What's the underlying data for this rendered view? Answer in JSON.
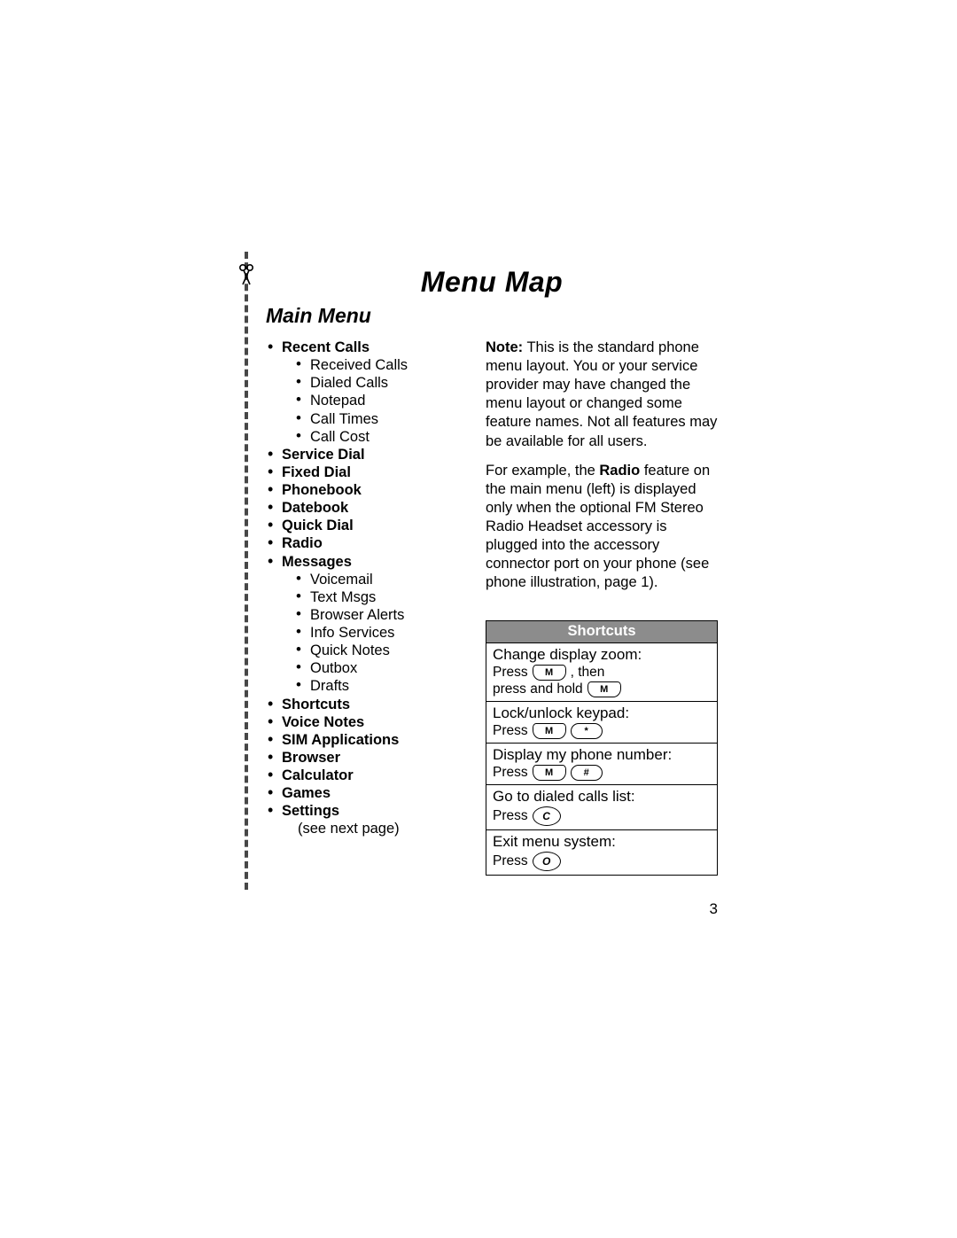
{
  "page_number": "3",
  "title": "Menu Map",
  "subtitle": "Main Menu",
  "menu": [
    {
      "label": "Recent Calls",
      "children": [
        {
          "label": "Received Calls"
        },
        {
          "label": "Dialed Calls"
        },
        {
          "label": "Notepad"
        },
        {
          "label": "Call Times"
        },
        {
          "label": "Call Cost"
        }
      ]
    },
    {
      "label": "Service Dial"
    },
    {
      "label": "Fixed Dial"
    },
    {
      "label": "Phonebook"
    },
    {
      "label": "Datebook"
    },
    {
      "label": "Quick Dial"
    },
    {
      "label": "Radio"
    },
    {
      "label": "Messages",
      "children": [
        {
          "label": "Voicemail"
        },
        {
          "label": "Text Msgs"
        },
        {
          "label": "Browser Alerts"
        },
        {
          "label": "Info Services"
        },
        {
          "label": "Quick Notes"
        },
        {
          "label": "Outbox"
        },
        {
          "label": "Drafts"
        }
      ]
    },
    {
      "label": "Shortcuts"
    },
    {
      "label": "Voice Notes"
    },
    {
      "label": "SIM Applications"
    },
    {
      "label": "Browser"
    },
    {
      "label": "Calculator"
    },
    {
      "label": "Games"
    },
    {
      "label": "Settings",
      "note": "(see next page)"
    }
  ],
  "note": {
    "prefix": "Note:",
    "body": " This is the standard phone menu layout. You or your service provider may have changed the menu layout or changed some feature names. Not all features may be available for all users."
  },
  "radio_para": {
    "pre": "For example, the ",
    "bold": "Radio",
    "post": " feature on the main menu (left) is displayed only when the optional FM Stereo Radio Headset accessory is plugged into the accessory connector port on your phone (see phone illustration, page 1)."
  },
  "shortcuts": {
    "header": "Shortcuts",
    "rows": [
      {
        "title": "Change display zoom:",
        "line": [
          {
            "t": "text",
            "v": "Press "
          },
          {
            "t": "key",
            "style": "cap",
            "v": "M"
          },
          {
            "t": "text",
            "v": ", then"
          }
        ],
        "line2": [
          {
            "t": "text",
            "v": "press and hold "
          },
          {
            "t": "key",
            "style": "cap",
            "v": "M"
          }
        ]
      },
      {
        "title": "Lock/unlock keypad:",
        "line": [
          {
            "t": "text",
            "v": "Press "
          },
          {
            "t": "key",
            "style": "cap",
            "v": "M"
          },
          {
            "t": "key",
            "style": "oval",
            "v": "*"
          }
        ]
      },
      {
        "title": "Display my phone number:",
        "line": [
          {
            "t": "text",
            "v": "Press "
          },
          {
            "t": "key",
            "style": "cap",
            "v": "M"
          },
          {
            "t": "key",
            "style": "oval",
            "v": "#"
          }
        ]
      },
      {
        "title": "Go to dialed calls list:",
        "line": [
          {
            "t": "text",
            "v": "Press "
          },
          {
            "t": "key",
            "style": "round",
            "v": "C"
          }
        ]
      },
      {
        "title": "Exit menu system:",
        "line": [
          {
            "t": "text",
            "v": "Press "
          },
          {
            "t": "key",
            "style": "round",
            "v": "O"
          }
        ]
      }
    ]
  }
}
